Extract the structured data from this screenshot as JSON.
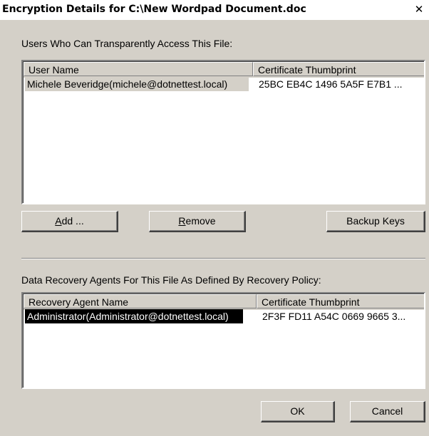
{
  "window": {
    "title": "Encryption Details for C:\\New Wordpad Document.doc",
    "close_glyph": "✕"
  },
  "users_section": {
    "label": "Users Who Can Transparently Access This File:",
    "columns": [
      "User Name",
      "Certificate Thumbprint"
    ],
    "rows": [
      {
        "name": "Michele Beveridge(michele@dotnettest.local)",
        "thumbprint": "25BC EB4C 1496 5A5F E7B1 ..."
      }
    ]
  },
  "buttons": {
    "add": {
      "underline": "A",
      "rest": "dd ..."
    },
    "remove": {
      "underline": "R",
      "rest": "emove"
    },
    "backup_keys": "Backup Keys",
    "ok": "OK",
    "cancel": "Cancel"
  },
  "recovery_section": {
    "label": "Data Recovery Agents For This File As Defined By Recovery Policy:",
    "columns": [
      "Recovery Agent Name",
      "Certificate Thumbprint"
    ],
    "rows": [
      {
        "name": "Administrator(Administrator@dotnettest.local)",
        "thumbprint": "2F3F FD11 A54C 0669 9665 3..."
      }
    ]
  },
  "colors": {
    "dialog_bg": "#d4d0c8",
    "list_bg": "#ffffff",
    "selection_black": "#000000"
  }
}
